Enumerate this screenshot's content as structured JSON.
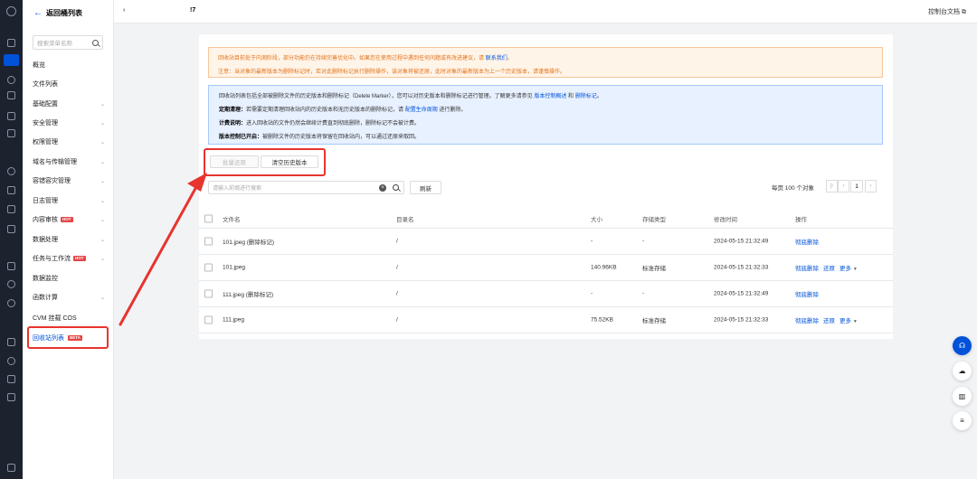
{
  "topbar": {
    "crumb": "‹",
    "crumb2": "!7",
    "doc_link": "控制台文档 ⧉"
  },
  "side": {
    "back_label": "返回桶列表",
    "search_placeholder": "搜索菜单名称",
    "items": [
      {
        "label": "概览",
        "chev": ""
      },
      {
        "label": "文件列表",
        "chev": ""
      },
      {
        "label": "基础配置",
        "chev": "⌄"
      },
      {
        "label": "安全管理",
        "chev": "⌄"
      },
      {
        "label": "权限管理",
        "chev": "⌄"
      },
      {
        "label": "域名与传输管理",
        "chev": "⌄"
      },
      {
        "label": "容错容灾管理",
        "chev": "⌄"
      },
      {
        "label": "日志管理",
        "chev": "⌄"
      },
      {
        "label": "内容审核",
        "chev": "⌄",
        "badge": "HOT"
      },
      {
        "label": "数据处理",
        "chev": "⌄"
      },
      {
        "label": "任务与工作流",
        "chev": "⌄",
        "badge": "HOT"
      },
      {
        "label": "数据监控",
        "chev": ""
      },
      {
        "label": "函数计算",
        "chev": "⌄"
      },
      {
        "label": "CVM 挂载 COS",
        "chev": ""
      },
      {
        "label": "回收站列表",
        "chev": "",
        "badge": "BETA"
      }
    ]
  },
  "warn": {
    "line1_a": "回收站目前处于内测阶段，部分功能仍在持续完善优化中。如果您在使用过程中遇到任何问题或有改进建议，请",
    "line1_link": "联系我们",
    "line1_b": "。",
    "line2": "注意：当对象的最新版本为删除标记时，若对此删除标记执行删除操作，该对象将被还原，此时对象的最新版本为上一个历史版本，请谨慎操作。"
  },
  "info": {
    "line1_a": "回收站列表包括全部被删除文件的历史版本和删除标记（Delete Marker），您可以对历史版本和删除标记进行管理。了解更多请参见",
    "line1_link1": "版本控制概述",
    "line1_and": "和",
    "line1_link2": "删除标记",
    "line1_b": "。",
    "line2_b": "定期清理：",
    "line2_a": "若需要定期清理回收站内的历史版本和无历史版本的删除标记，请",
    "line2_link": "配置生命周期",
    "line2_c": "进行删除。",
    "line3_b": "计费说明：",
    "line3_a": "进入回收站的文件仍然会继续计费直到彻底删除，删除标记不会被计费。",
    "line4_b": "版本控制已开启：",
    "line4_a": "被删除文件的历史版本将保留在回收站内，可以通过还原来取回。"
  },
  "toolbar": {
    "batch_restore": "批量还原",
    "clear_history": "清空历史版本",
    "search_placeholder": "请输入前缀进行搜索",
    "clear_icon": "×",
    "refresh": "刷新",
    "page_size_text": "每页 100 个对象",
    "page_first": "|‹",
    "page_prev": "‹",
    "page_num": "1",
    "page_next": "›"
  },
  "table": {
    "headers": [
      "文件名",
      "目录名",
      "大小",
      "存储类型",
      "修改时间",
      "操作"
    ],
    "rows": [
      {
        "name": "101.jpeg (删除标记)",
        "dir": "/",
        "size": "-",
        "type": "-",
        "time": "2024-05-15 21:32:49",
        "op1": "彻底删除",
        "op2": "",
        "op3": ""
      },
      {
        "name": "101.jpeg",
        "dir": "/",
        "size": "140.96KB",
        "type": "标准存储",
        "time": "2024-05-15 21:32:33",
        "op1": "彻底删除",
        "op2": "还原",
        "op3": "更多"
      },
      {
        "name": "111.jpeg (删除标记)",
        "dir": "/",
        "size": "-",
        "type": "-",
        "time": "2024-05-15 21:32:49",
        "op1": "彻底删除",
        "op2": "",
        "op3": ""
      },
      {
        "name": "111.jpeg",
        "dir": "/",
        "size": "75.52KB",
        "type": "标准存储",
        "time": "2024-05-15 21:32:33",
        "op1": "彻底删除",
        "op2": "还原",
        "op3": "更多"
      }
    ]
  },
  "colors": {
    "accent": "#0052d9",
    "highlight": "#e7342e",
    "warn_text": "#e37318"
  }
}
